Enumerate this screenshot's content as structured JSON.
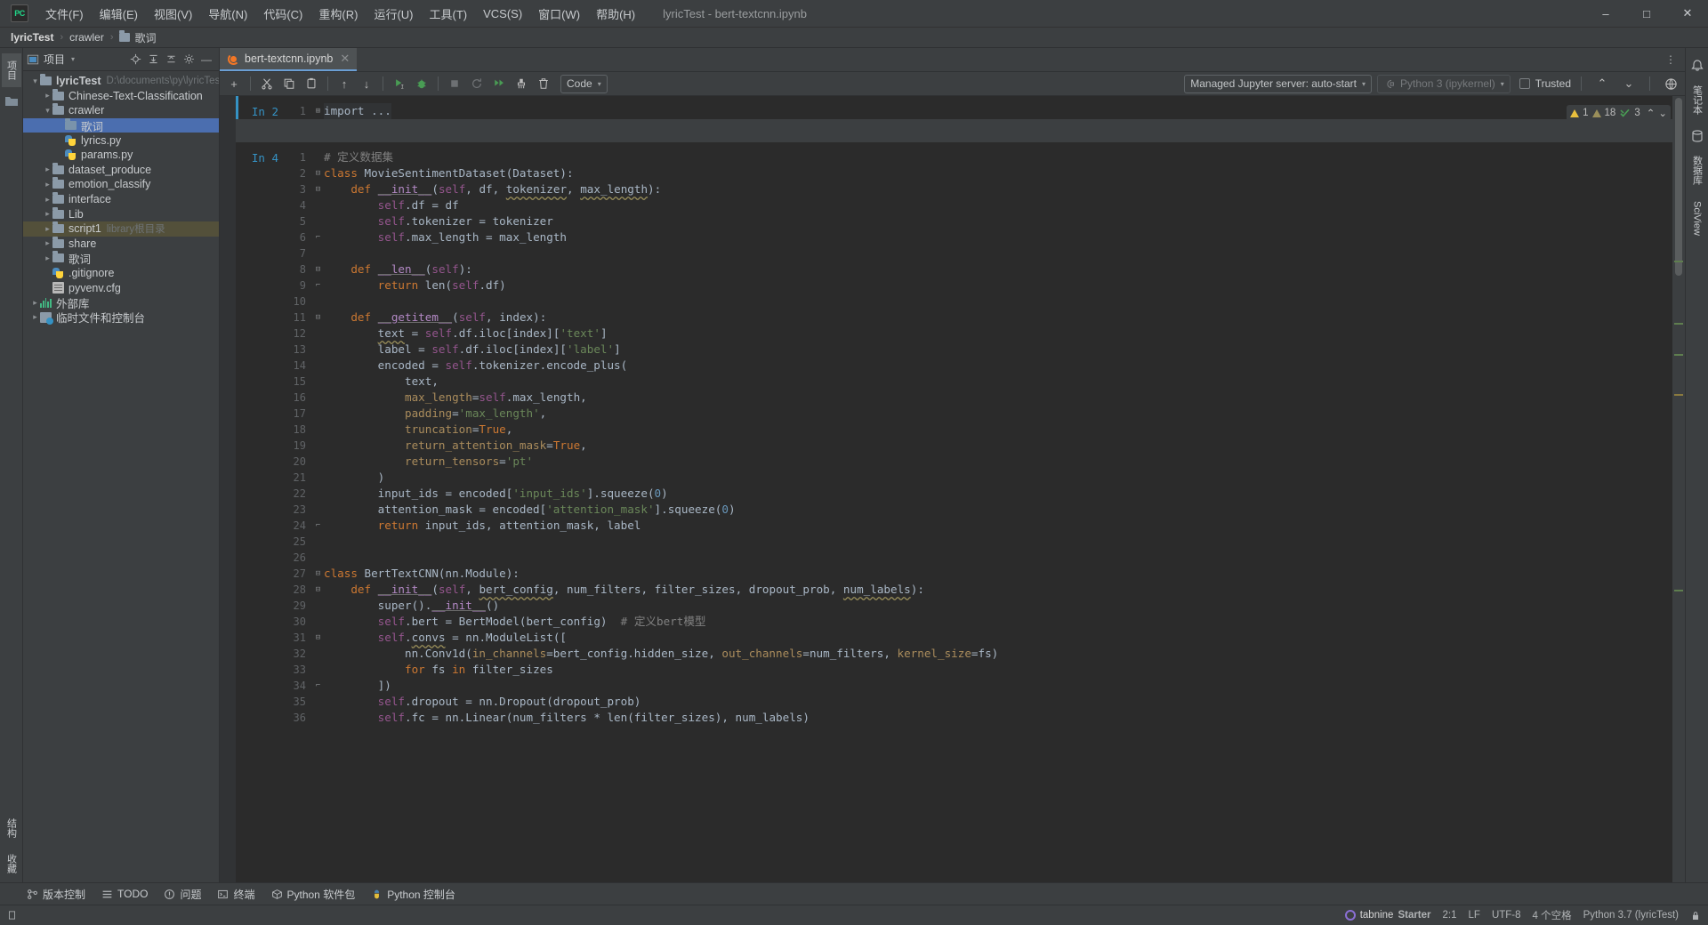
{
  "window": {
    "title": "lyricTest - bert-textcnn.ipynb",
    "logo": "PC",
    "minimize": "–",
    "maximize": "□",
    "close": "✕"
  },
  "menu": [
    {
      "label": "文件(F)",
      "name": "menu-file"
    },
    {
      "label": "编辑(E)",
      "name": "menu-edit"
    },
    {
      "label": "视图(V)",
      "name": "menu-view"
    },
    {
      "label": "导航(N)",
      "name": "menu-navigate"
    },
    {
      "label": "代码(C)",
      "name": "menu-code"
    },
    {
      "label": "重构(R)",
      "name": "menu-refactor"
    },
    {
      "label": "运行(U)",
      "name": "menu-run"
    },
    {
      "label": "工具(T)",
      "name": "menu-tools"
    },
    {
      "label": "VCS(S)",
      "name": "menu-vcs"
    },
    {
      "label": "窗口(W)",
      "name": "menu-window"
    },
    {
      "label": "帮助(H)",
      "name": "menu-help"
    }
  ],
  "breadcrumb": {
    "project": "lyricTest",
    "folder": "crawler",
    "current": "歌词",
    "separator": "›"
  },
  "left_strip": {
    "project_tab": "项目",
    "structure_tab": "结构",
    "favorites_tab": "收藏"
  },
  "right_strip": {
    "notebook_tab": "笔记本",
    "database_tab": "数据库",
    "sciview_tab": "SciView"
  },
  "project_panel": {
    "title": "项目",
    "tree": [
      {
        "label": "lyricTest",
        "sub": "D:\\documents\\py\\lyricTest",
        "depth": 0,
        "arrow": "v",
        "icon": "folder",
        "bold": true,
        "selected": false,
        "name": "tree-node-lyrictest"
      },
      {
        "label": "Chinese-Text-Classification",
        "sub": "",
        "depth": 1,
        "arrow": ">",
        "icon": "folder",
        "bold": false,
        "selected": false,
        "name": "tree-node-chinese-text-classification"
      },
      {
        "label": "crawler",
        "sub": "",
        "depth": 1,
        "arrow": "v",
        "icon": "folder",
        "bold": false,
        "selected": false,
        "name": "tree-node-crawler"
      },
      {
        "label": "歌词",
        "sub": "",
        "depth": 2,
        "arrow": "",
        "icon": "folder-blue",
        "bold": false,
        "selected": true,
        "name": "tree-node-geci-crawler"
      },
      {
        "label": "lyrics.py",
        "sub": "",
        "depth": 2,
        "arrow": "",
        "icon": "python",
        "bold": false,
        "selected": false,
        "name": "tree-node-lyrics-py"
      },
      {
        "label": "params.py",
        "sub": "",
        "depth": 2,
        "arrow": "",
        "icon": "python",
        "bold": false,
        "selected": false,
        "name": "tree-node-params-py"
      },
      {
        "label": "dataset_produce",
        "sub": "",
        "depth": 1,
        "arrow": ">",
        "icon": "folder",
        "bold": false,
        "selected": false,
        "name": "tree-node-dataset-produce"
      },
      {
        "label": "emotion_classify",
        "sub": "",
        "depth": 1,
        "arrow": ">",
        "icon": "folder",
        "bold": false,
        "selected": false,
        "name": "tree-node-emotion-classify"
      },
      {
        "label": "interface",
        "sub": "",
        "depth": 1,
        "arrow": ">",
        "icon": "folder",
        "bold": false,
        "selected": false,
        "name": "tree-node-interface"
      },
      {
        "label": "Lib",
        "sub": "",
        "depth": 1,
        "arrow": ">",
        "icon": "folder",
        "bold": false,
        "selected": false,
        "name": "tree-node-lib"
      },
      {
        "label": "script1",
        "sub": "library根目录",
        "depth": 1,
        "arrow": ">",
        "icon": "folder",
        "bold": false,
        "selected": false,
        "library": true,
        "name": "tree-node-script1"
      },
      {
        "label": "share",
        "sub": "",
        "depth": 1,
        "arrow": ">",
        "icon": "folder",
        "bold": false,
        "selected": false,
        "name": "tree-node-share"
      },
      {
        "label": "歌词",
        "sub": "",
        "depth": 1,
        "arrow": ">",
        "icon": "folder",
        "bold": false,
        "selected": false,
        "name": "tree-node-geci-root"
      },
      {
        "label": ".gitignore",
        "sub": "",
        "depth": 1,
        "arrow": "",
        "icon": "gitignore",
        "bold": false,
        "selected": false,
        "name": "tree-node-gitignore"
      },
      {
        "label": "pyvenv.cfg",
        "sub": "",
        "depth": 1,
        "arrow": "",
        "icon": "cfg",
        "bold": false,
        "selected": false,
        "name": "tree-node-pyvenv-cfg"
      },
      {
        "label": "外部库",
        "sub": "",
        "depth": 0,
        "arrow": ">",
        "icon": "lib",
        "bold": false,
        "selected": false,
        "name": "tree-node-external-libraries"
      },
      {
        "label": "临时文件和控制台",
        "sub": "",
        "depth": 0,
        "arrow": ">",
        "icon": "scratch",
        "bold": false,
        "selected": false,
        "name": "tree-node-scratches-consoles"
      }
    ]
  },
  "editor_tab": {
    "filename": "bert-textcnn.ipynb",
    "close": "✕"
  },
  "notebook_toolbar": {
    "add": "+",
    "cut": "✂",
    "copy": "⧉",
    "paste": "📋",
    "move_up": "↑",
    "move_down": "↓",
    "run_cell": "▶",
    "debug_cell": "🐞",
    "interrupt": "■",
    "restart": "↻",
    "run_all": "▶▶",
    "clear_outputs": "⌁",
    "delete_cell": "🗑",
    "cell_type": "Code",
    "server": "Managed Jupyter server: auto-start",
    "kernel": "Python 3 (ipykernel)",
    "trusted": "Trusted",
    "prev": "⌃",
    "next": "⌄"
  },
  "inspection": {
    "warnings": "1",
    "weak_warnings": "18",
    "ok": "3",
    "up": "⌃",
    "down": "⌄"
  },
  "cells": [
    {
      "label": "In 2",
      "name": "notebook-cell-1",
      "active": true,
      "lines": [
        {
          "n": "1",
          "fold": "+",
          "html": "import ..."
        }
      ]
    },
    {
      "label": "In 4",
      "name": "notebook-cell-2",
      "active": false,
      "lines": [
        {
          "n": "1",
          "fold": "",
          "html": "<span class=\"com\"># 定义数据集</span>"
        },
        {
          "n": "2",
          "fold": "-",
          "html": "<span class=\"kw\">class</span> MovieSentimentDataset(Dataset):"
        },
        {
          "n": "3",
          "fold": "-",
          "html": "    <span class=\"kw\">def</span> <span class=\"fn uline\">__init__</span>(<span class=\"self\">self</span>, df, <span class=\"wave\">tokenizer</span>, <span class=\"wave\">max_length</span>):"
        },
        {
          "n": "4",
          "fold": "",
          "html": "        <span class=\"self\">self</span>.df = df"
        },
        {
          "n": "5",
          "fold": "",
          "html": "        <span class=\"self\">self</span>.tokenizer = tokenizer"
        },
        {
          "n": "6",
          "fold": "⌐",
          "html": "        <span class=\"self\">self</span>.max_length = max_length"
        },
        {
          "n": "7",
          "fold": "",
          "html": ""
        },
        {
          "n": "8",
          "fold": "-",
          "html": "    <span class=\"kw\">def</span> <span class=\"fn uline\">__len__</span>(<span class=\"self\">self</span>):"
        },
        {
          "n": "9",
          "fold": "⌐",
          "html": "        <span class=\"kw\">return</span> len(<span class=\"self\">self</span>.df)"
        },
        {
          "n": "10",
          "fold": "",
          "html": ""
        },
        {
          "n": "11",
          "fold": "-",
          "html": "    <span class=\"kw\">def</span> <span class=\"fn uline\">__getitem__</span>(<span class=\"self\">self</span>, index):"
        },
        {
          "n": "12",
          "fold": "",
          "html": "        <span class=\"wave\">text</span> = <span class=\"self\">self</span>.df.iloc[index][<span class=\"str\">'text'</span>]"
        },
        {
          "n": "13",
          "fold": "",
          "html": "        label = <span class=\"self\">self</span>.df.iloc[index][<span class=\"str\">'label'</span>]"
        },
        {
          "n": "14",
          "fold": "",
          "html": "        encoded = <span class=\"self\">self</span>.tokenizer.encode_plus("
        },
        {
          "n": "15",
          "fold": "",
          "html": "            text,"
        },
        {
          "n": "16",
          "fold": "",
          "html": "            <span class=\"kwarg\">max_length</span>=<span class=\"self\">self</span>.max_length,"
        },
        {
          "n": "17",
          "fold": "",
          "html": "            <span class=\"kwarg\">padding</span>=<span class=\"str\">'max_length'</span>,"
        },
        {
          "n": "18",
          "fold": "",
          "html": "            <span class=\"kwarg\">truncation</span>=<span class=\"kw\">True</span>,"
        },
        {
          "n": "19",
          "fold": "",
          "html": "            <span class=\"kwarg\">return_attention_mask</span>=<span class=\"kw\">True</span>,"
        },
        {
          "n": "20",
          "fold": "",
          "html": "            <span class=\"kwarg\">return_tensors</span>=<span class=\"str\">'pt'</span>"
        },
        {
          "n": "21",
          "fold": "",
          "html": "        )"
        },
        {
          "n": "22",
          "fold": "",
          "html": "        input_ids = encoded[<span class=\"str\">'input_ids'</span>].squeeze(<span class=\"num2\">0</span>)"
        },
        {
          "n": "23",
          "fold": "",
          "html": "        attention_mask = encoded[<span class=\"str\">'attention_mask'</span>].squeeze(<span class=\"num2\">0</span>)"
        },
        {
          "n": "24",
          "fold": "⌐",
          "html": "        <span class=\"kw\">return</span> input_ids, attention_mask, label"
        },
        {
          "n": "25",
          "fold": "",
          "html": ""
        },
        {
          "n": "26",
          "fold": "",
          "html": ""
        },
        {
          "n": "27",
          "fold": "-",
          "html": "<span class=\"kw\">class</span> BertTextCNN(nn.Module):"
        },
        {
          "n": "28",
          "fold": "-",
          "html": "    <span class=\"kw\">def</span> <span class=\"fn uline\">__init__</span>(<span class=\"self\">self</span>, <span class=\"wave\">bert_config</span>, num_filters, filter_sizes, dropout_prob, <span class=\"wave\">num_labels</span>):"
        },
        {
          "n": "29",
          "fold": "",
          "html": "        super().<span class=\"fn uline\">__init__</span>()"
        },
        {
          "n": "30",
          "fold": "",
          "html": "        <span class=\"self\">self</span>.bert = BertModel(bert_config)  <span class=\"com\"># 定义bert模型</span>"
        },
        {
          "n": "31",
          "fold": "-",
          "html": "        <span class=\"self\">self</span>.<span class=\"wave\">convs</span> = nn.ModuleList(["
        },
        {
          "n": "32",
          "fold": "",
          "html": "            nn.Conv1d(<span class=\"kwarg\">in_channels</span>=bert_config.hidden_size, <span class=\"kwarg\">out_channels</span>=num_filters, <span class=\"kwarg\">kernel_size</span>=fs)"
        },
        {
          "n": "33",
          "fold": "",
          "html": "            <span class=\"kw\">for</span> fs <span class=\"kw\">in</span> filter_sizes"
        },
        {
          "n": "34",
          "fold": "⌐",
          "html": "        ])"
        },
        {
          "n": "35",
          "fold": "",
          "html": "        <span class=\"self\">self</span>.dropout = nn.Dropout(dropout_prob)"
        },
        {
          "n": "36",
          "fold": "",
          "html": "        <span class=\"self\">self</span>.fc = nn.Linear(num_filters * len(filter_sizes), num_labels)"
        }
      ]
    }
  ],
  "bottom_tools": [
    {
      "label": "版本控制",
      "icon": "branch-icon",
      "name": "bottom-tool-version-control"
    },
    {
      "label": "TODO",
      "icon": "list-icon",
      "name": "bottom-tool-todo"
    },
    {
      "label": "问题",
      "icon": "warning-icon",
      "name": "bottom-tool-problems"
    },
    {
      "label": "终端",
      "icon": "terminal-icon",
      "name": "bottom-tool-terminal"
    },
    {
      "label": "Python 软件包",
      "icon": "package-icon",
      "name": "bottom-tool-python-packages"
    },
    {
      "label": "Python 控制台",
      "icon": "console-icon",
      "name": "bottom-tool-python-console"
    }
  ],
  "status_bar": {
    "tabnine_brand": "tabnine",
    "tabnine_plan": "Starter",
    "caret": "2:1",
    "line_sep": "LF",
    "encoding": "UTF-8",
    "indent": "4 个空格",
    "interpreter": "Python 3.7 (lyricTest)",
    "lock": "🔒"
  },
  "colors": {
    "accent_blue": "#3592c4",
    "selection_blue": "#4b6eaf",
    "library_olive": "#53503a",
    "editor_bg": "#2b2b2b",
    "panel_bg": "#3c3f41",
    "green_run": "#499c54",
    "warning_yellow": "#e8bf3d"
  }
}
